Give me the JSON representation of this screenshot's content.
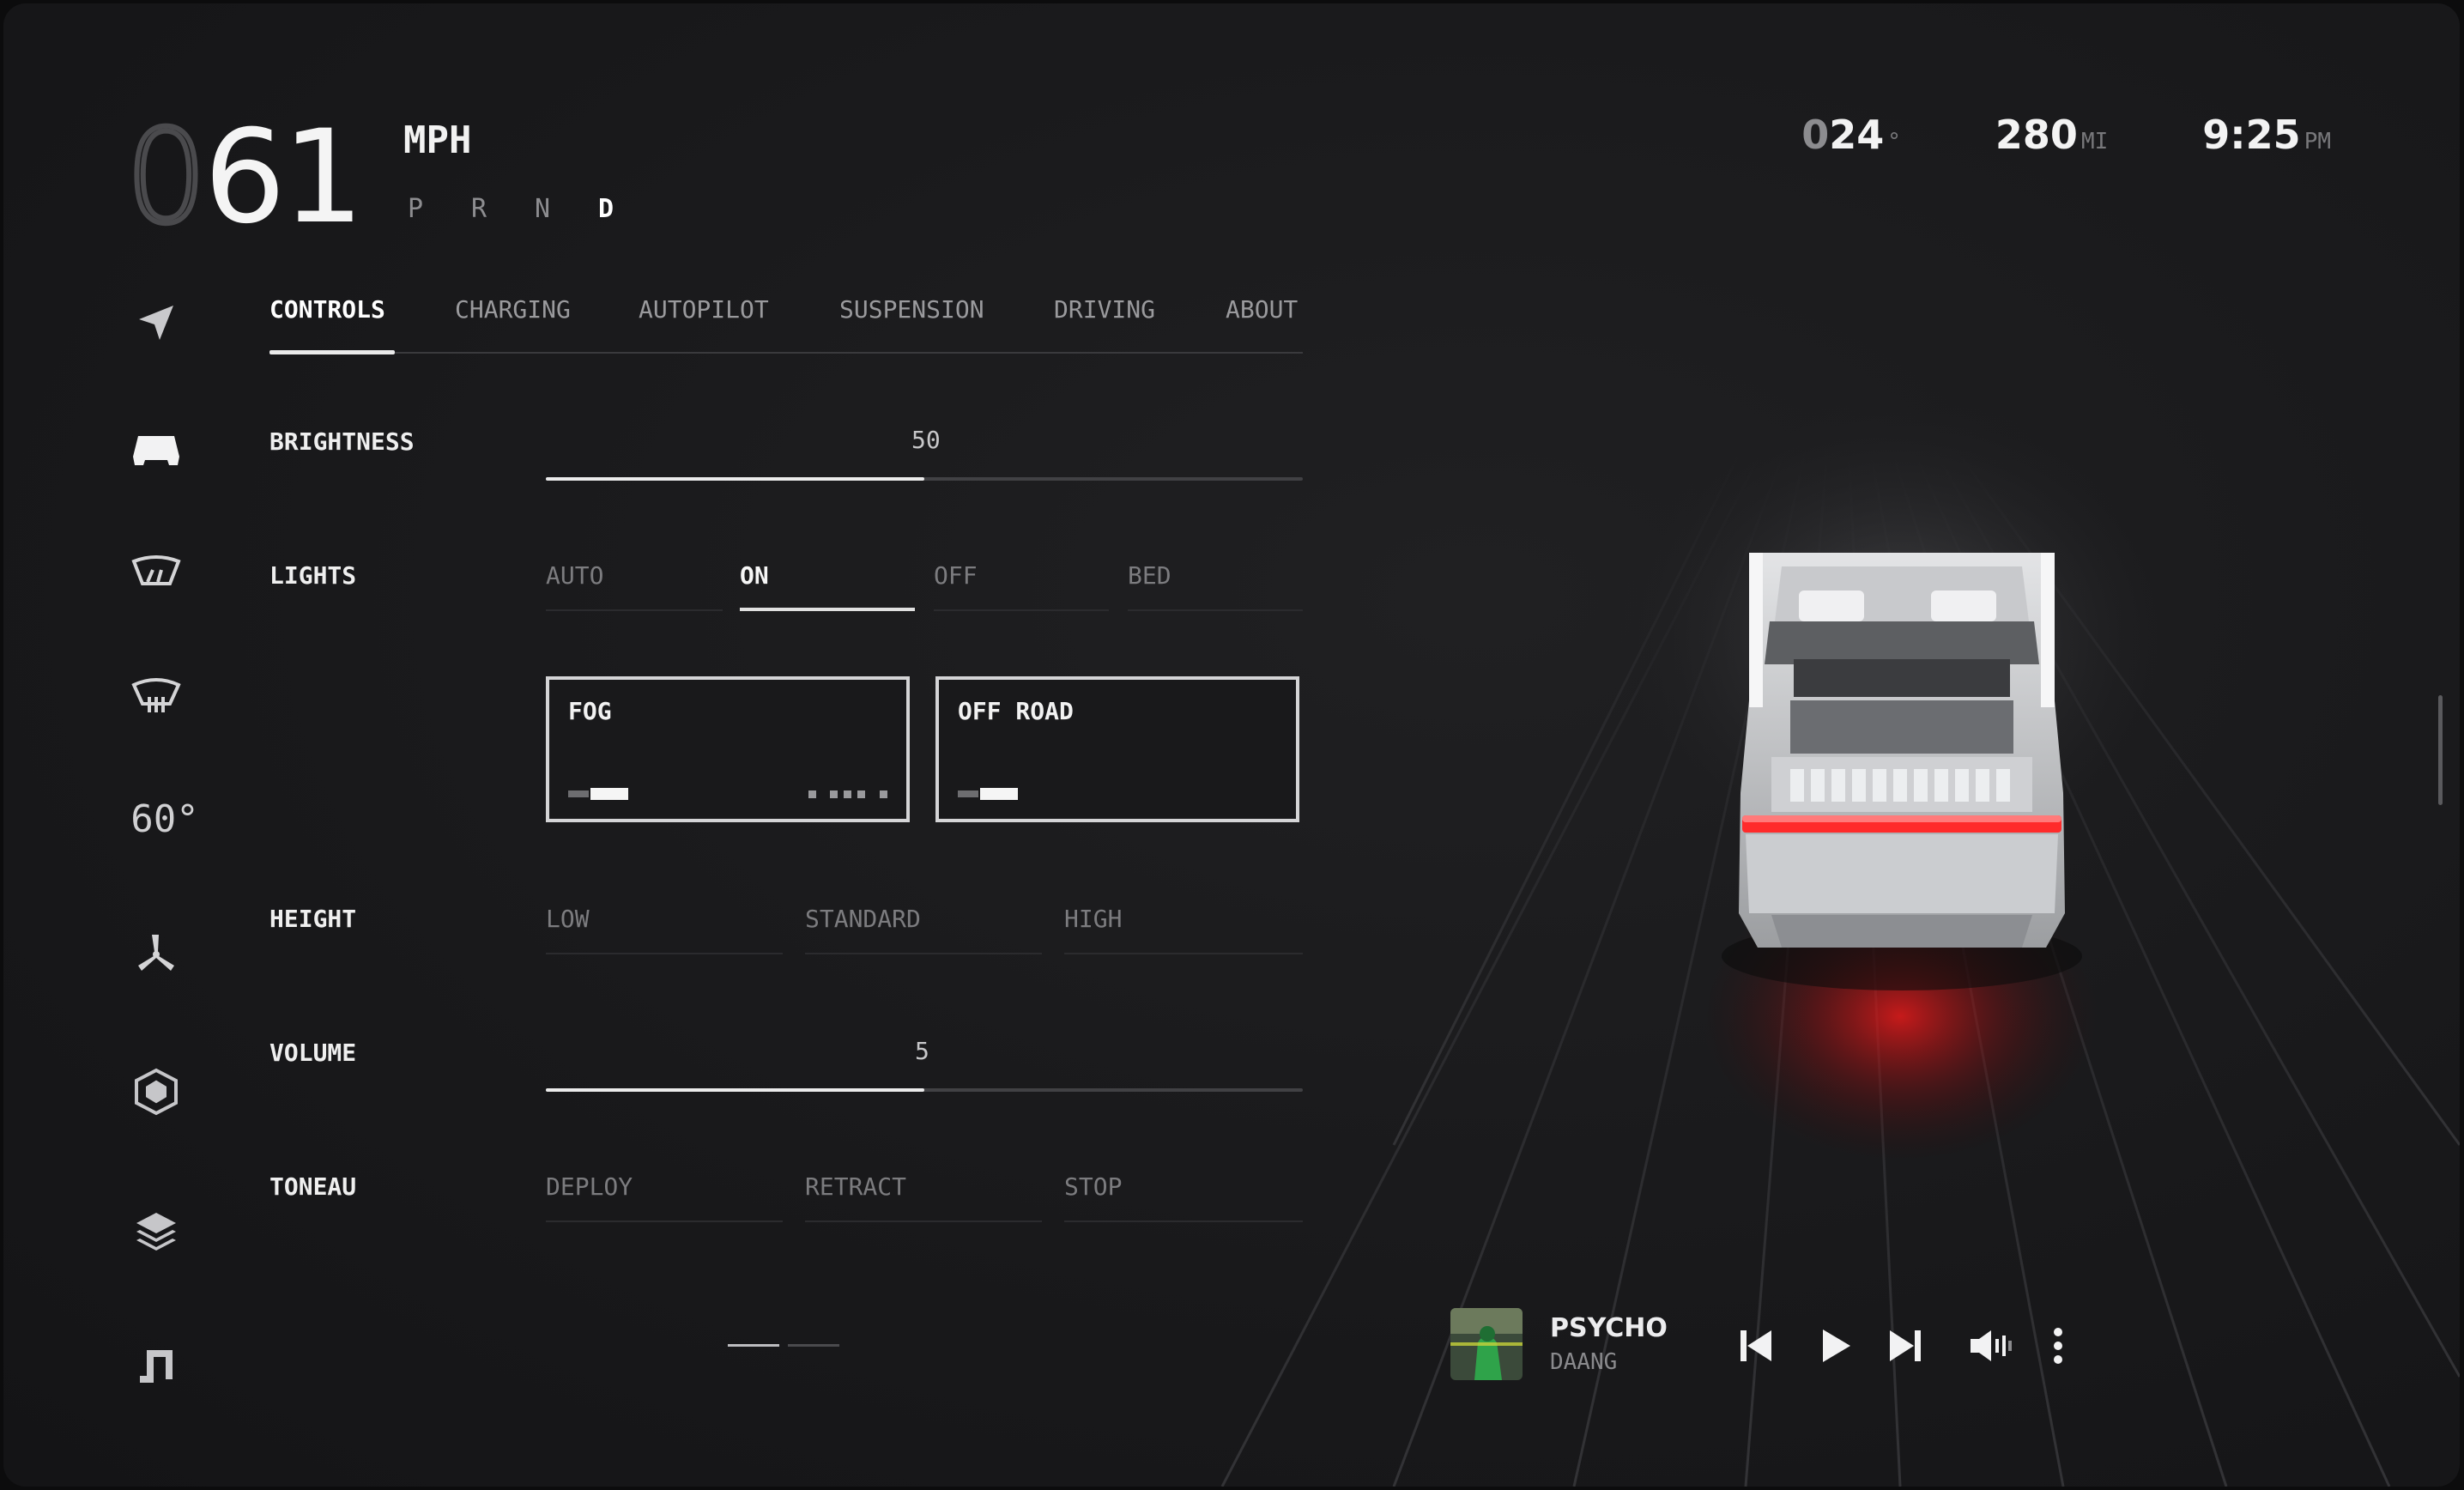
{
  "speed": {
    "leading_digit": "0",
    "value": "61",
    "unit": "MPH"
  },
  "gears": {
    "items": [
      "P",
      "R",
      "N",
      "D"
    ],
    "active": "D"
  },
  "status": {
    "temperature": {
      "lead": "0",
      "value": "24",
      "unit": "°"
    },
    "range": {
      "value": "280",
      "unit": "MI"
    },
    "clock": {
      "value": "9:25",
      "unit": "PM"
    }
  },
  "sidebar": {
    "items": [
      {
        "icon": "navigation-arrow-icon"
      },
      {
        "icon": "car-front-icon"
      },
      {
        "icon": "front-defrost-icon"
      },
      {
        "icon": "rear-defrost-icon"
      },
      {
        "icon": "climate-temperature",
        "label": "60°"
      },
      {
        "icon": "fan-icon"
      },
      {
        "icon": "settings-hex-icon"
      },
      {
        "icon": "layers-icon"
      },
      {
        "icon": "music-note-icon"
      }
    ]
  },
  "tabs": [
    "CONTROLS",
    "CHARGING",
    "AUTOPILOT",
    "SUSPENSION",
    "DRIVING",
    "ABOUT"
  ],
  "active_tab": "CONTROLS",
  "controls": {
    "brightness": {
      "label": "BRIGHTNESS",
      "value": "50",
      "fraction": 0.5
    },
    "lights": {
      "label": "LIGHTS",
      "options": [
        "AUTO",
        "ON",
        "OFF",
        "BED"
      ],
      "selected": "ON"
    },
    "light_cards": {
      "fog": "FOG",
      "off_road": "OFF ROAD"
    },
    "height": {
      "label": "HEIGHT",
      "options": [
        "LOW",
        "STANDARD",
        "HIGH"
      ]
    },
    "volume": {
      "label": "VOLUME",
      "value": "5",
      "fraction": 0.5
    },
    "tonneau": {
      "label": "TONEAU",
      "options": [
        "DEPLOY",
        "RETRACT",
        "STOP"
      ]
    }
  },
  "pager": {
    "pages": 2,
    "current": 1
  },
  "media": {
    "title": "PSYCHO",
    "artist": "DAANG",
    "controls": [
      "previous-track-icon",
      "play-icon",
      "next-track-icon",
      "volume-icon",
      "more-vertical-icon"
    ]
  },
  "colors": {
    "background": "#19191b",
    "text_primary": "#ffffff",
    "text_muted": "#8d8d90",
    "tail_light": "#ff2b2b"
  }
}
